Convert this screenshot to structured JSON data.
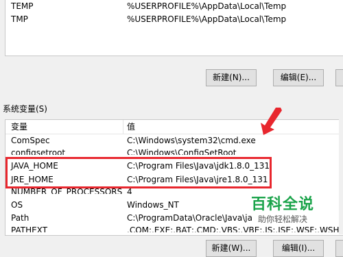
{
  "user_vars": {
    "rows": [
      {
        "name": "TEMP",
        "value": "%USERPROFILE%\\AppData\\Local\\Temp"
      },
      {
        "name": "TMP",
        "value": "%USERPROFILE%\\AppData\\Local\\Temp"
      }
    ],
    "new_button": "新建(N)...",
    "edit_button": "编辑(E)..."
  },
  "system_vars": {
    "section_label": "系统变量(S)",
    "header_variable": "变量",
    "header_value": "值",
    "rows": [
      {
        "name": "ComSpec",
        "value": "C:\\Windows\\system32\\cmd.exe"
      },
      {
        "name": "configsetroot",
        "value": "C:\\Windows\\ConfigSetRoot"
      },
      {
        "name": "JAVA_HOME",
        "value": "C:\\Program Files\\Java\\jdk1.8.0_131"
      },
      {
        "name": "JRE_HOME",
        "value": "C:\\Program Files\\Java\\jre1.8.0_131"
      },
      {
        "name": "NUMBER_OF_PROCESSORS",
        "value": "4"
      },
      {
        "name": "OS",
        "value": "Windows_NT"
      },
      {
        "name": "Path",
        "value": "C:\\ProgramData\\Oracle\\Java\\ja"
      },
      {
        "name": "PATHEXT",
        "value": ".COM;.EXE;.BAT;.CMD;.VBS;.VBE;.JS;.JSE;.WSF;.WSH;.MSC"
      }
    ],
    "new_button": "新建(W)...",
    "edit_button": "编辑(I)..."
  },
  "watermark": {
    "title": "百科全说",
    "subtitle": "助你轻松解决"
  },
  "colors": {
    "highlight": "#e8262d",
    "watermark": "#1aa34a"
  }
}
